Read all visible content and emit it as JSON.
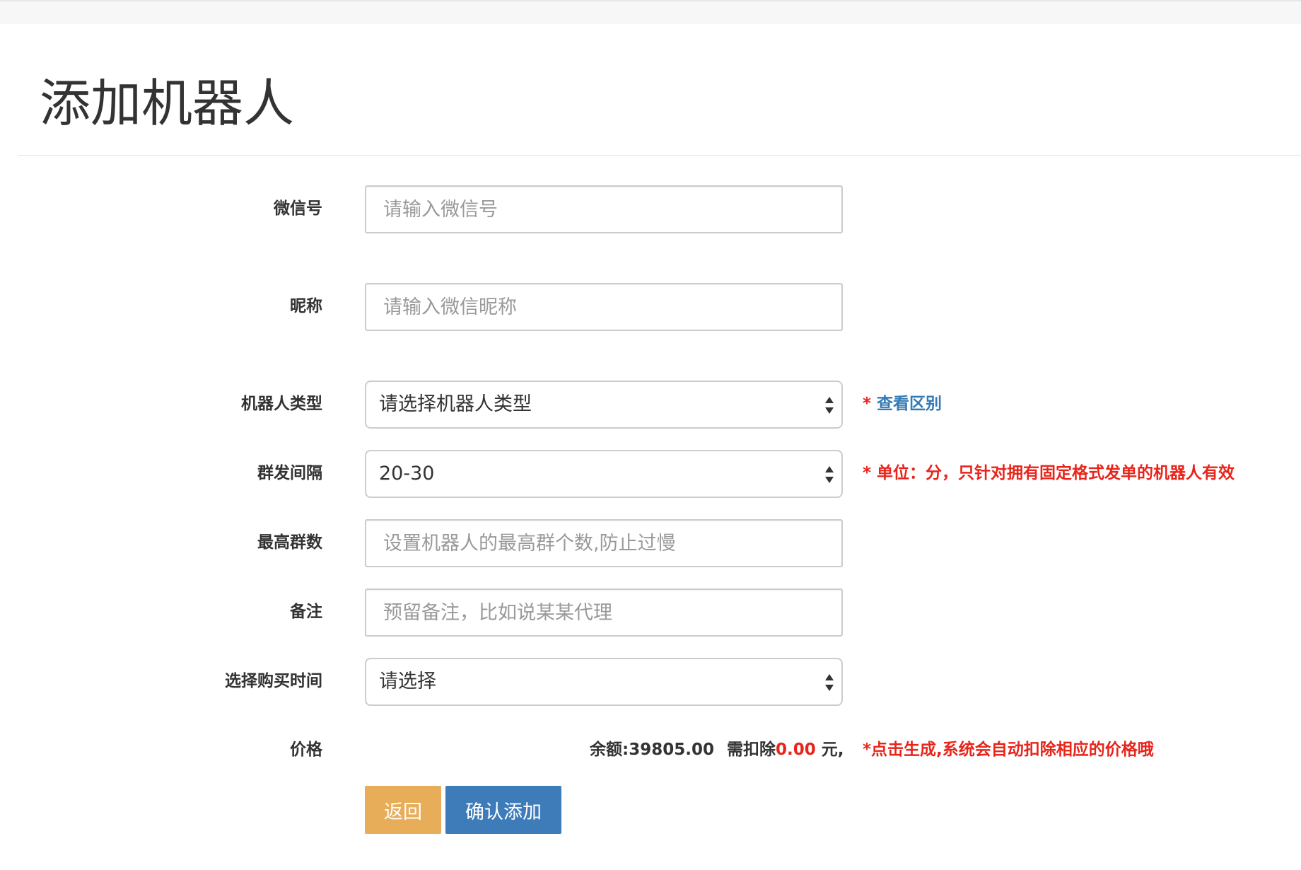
{
  "page": {
    "title": "添加机器人"
  },
  "form": {
    "wechat_id": {
      "label": "微信号",
      "placeholder": "请输入微信号"
    },
    "nickname": {
      "label": "昵称",
      "placeholder": "请输入微信昵称"
    },
    "robot_type": {
      "label": "机器人类型",
      "selected": "请选择机器人类型",
      "hint_star": "* ",
      "hint_link": "查看区别"
    },
    "interval": {
      "label": "群发间隔",
      "selected": "20-30",
      "hint": "* 单位：分，只针对拥有固定格式发单的机器人有效"
    },
    "max_groups": {
      "label": "最高群数",
      "placeholder": "设置机器人的最高群个数,防止过慢"
    },
    "remark": {
      "label": "备注",
      "placeholder": "预留备注，比如说某某代理"
    },
    "purchase_time": {
      "label": "选择购买时间",
      "selected": "请选择"
    },
    "price": {
      "label": "价格",
      "balance": "余额:39805.00",
      "deduct_prefix": "需扣除",
      "deduct_amount": "0.00",
      "deduct_suffix": " 元,",
      "hint": "*点击生成,系统会自动扣除相应的价格哦"
    }
  },
  "buttons": {
    "back_label": "返回",
    "confirm_label": "确认添加"
  },
  "colors": {
    "back_button": "#e8ad59",
    "confirm_button": "#3e7bb9",
    "hint_red": "#e8241b",
    "link_blue": "#337ab7"
  }
}
